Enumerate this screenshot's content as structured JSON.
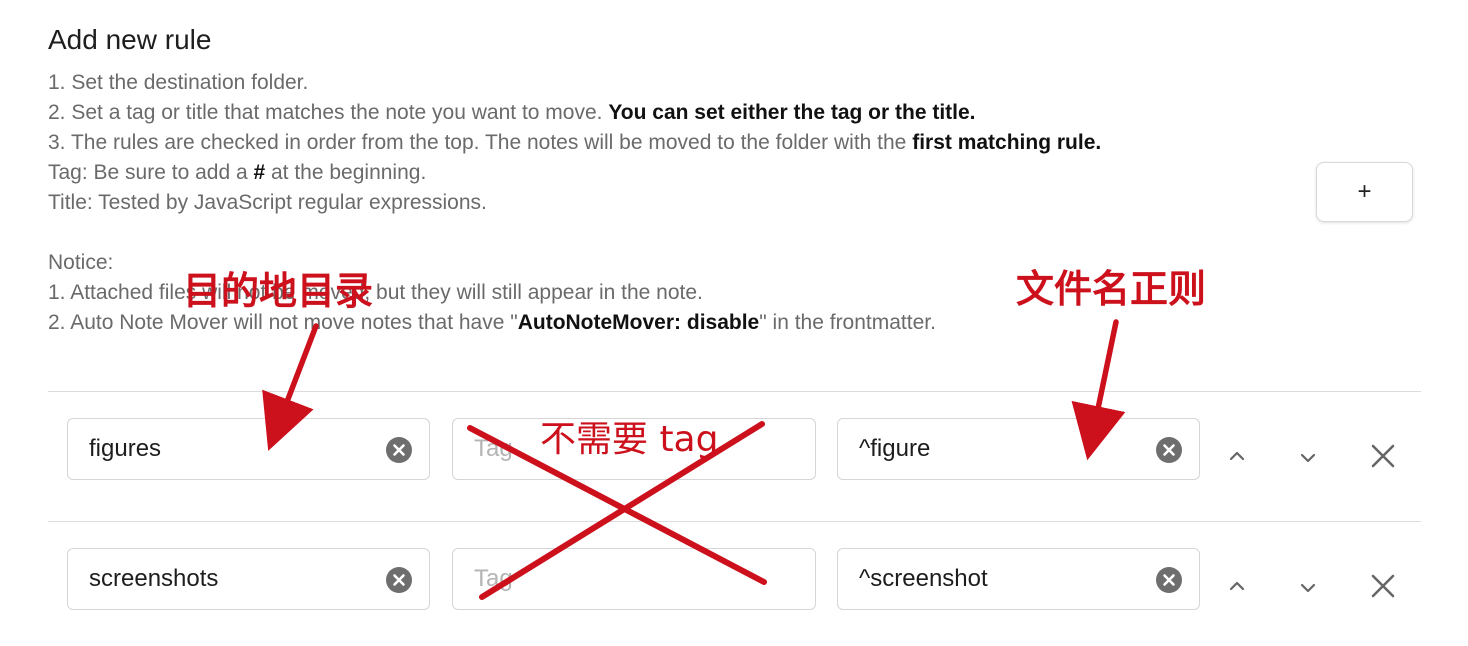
{
  "header": {
    "title": "Add new rule"
  },
  "description": {
    "step1": "1. Set the destination folder.",
    "step2_text": "2. Set a tag or title that matches the note you want to move. ",
    "step2_bold": "You can set either the tag or the title.",
    "step3_text": "3. The rules are checked in order from the top. The notes will be moved to the folder with the ",
    "step3_bold": "first matching rule.",
    "tag_pre": "Tag: Be sure to add a ",
    "tag_bold": "#",
    "tag_post": " at the beginning.",
    "title_line": "Title: Tested by JavaScript regular expressions.",
    "notice_label": "Notice:",
    "notice1": "1. Attached files will not be moved, but they will still appear in the note.",
    "notice2_pre": "2. Auto Note Mover will not move notes that have \"",
    "notice2_bold": "AutoNoteMover: disable",
    "notice2_post": "\" in the frontmatter."
  },
  "add_button": {
    "label": "+"
  },
  "rules": [
    {
      "folder": "figures",
      "tag_placeholder": "Tag",
      "title": "^figure"
    },
    {
      "folder": "screenshots",
      "tag_placeholder": "Tag",
      "title": "^screenshot"
    }
  ],
  "controls": {
    "move_up_icon": "chevron-up-icon",
    "move_down_icon": "chevron-down-icon",
    "delete_icon": "close-icon",
    "clear_icon": "clear-circle-icon"
  },
  "annotations": {
    "folder_note": "目的地目录",
    "title_note": "文件名正则",
    "tag_note": "不需要 tag",
    "color": "#cc101c"
  }
}
